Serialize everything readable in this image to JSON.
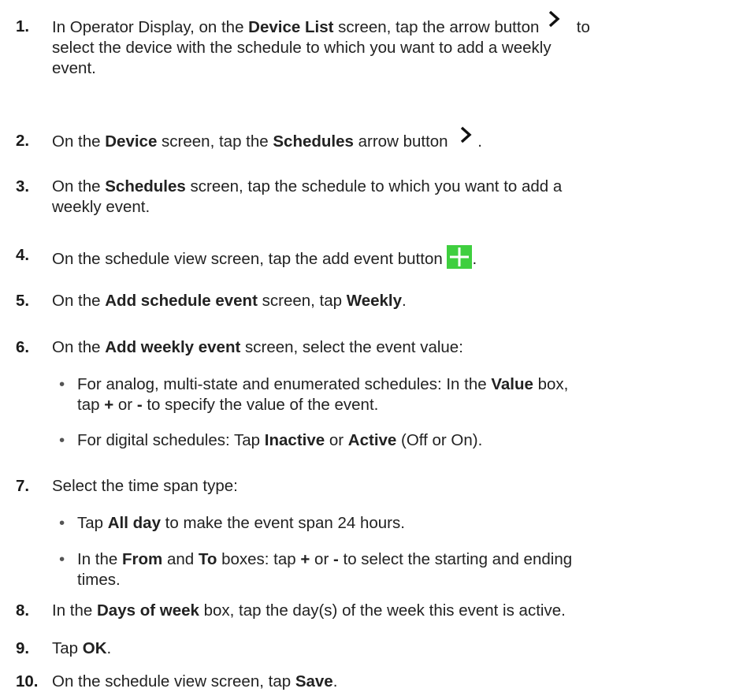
{
  "steps": [
    {
      "number": "1.",
      "p1": "In Operator Display, on the ",
      "b1": "Device List",
      "p2": " screen, tap the arrow button ",
      "p3": " to",
      "p4": "select the device with the schedule to which you want to add a weekly",
      "p5": "event."
    },
    {
      "number": "2.",
      "p1": "On the ",
      "b1": "Device",
      "p2": " screen, tap the ",
      "b2": "Schedules",
      "p3": " arrow button ",
      "p4": "."
    },
    {
      "number": "3.",
      "p1": "On the ",
      "b1": "Schedules",
      "p2": " screen, tap the schedule to which you want to add a",
      "p3": "weekly event."
    },
    {
      "number": "4.",
      "p1": "On the schedule view screen, tap the add event button ",
      "p2": "."
    },
    {
      "number": "5.",
      "p1": "On the ",
      "b1": "Add schedule event",
      "p2": " screen, tap ",
      "b2": "Weekly",
      "p3": "."
    },
    {
      "number": "6.",
      "p1": "On the ",
      "b1": "Add weekly event",
      "p2": " screen, select the event value:",
      "bullets": [
        {
          "p1": "For analog, multi-state and enumerated schedules: In the ",
          "b1": "Value",
          "p2": " box,",
          "p3": "tap ",
          "b2": "+",
          "p4": " or ",
          "b3": "-",
          "p5": " to specify the value of the event."
        },
        {
          "p1": "For digital schedules: Tap ",
          "b1": "Inactive",
          "p2": " or ",
          "b2": "Active",
          "p3": " (Off or On)."
        }
      ]
    },
    {
      "number": "7.",
      "p1": "Select the time span type:",
      "bullets": [
        {
          "p1": "Tap ",
          "b1": "All day",
          "p2": " to make the event span 24 hours."
        },
        {
          "p1": "In the ",
          "b1": "From",
          "p2": " and ",
          "b2": "To",
          "p3": " boxes: tap ",
          "b3": "+",
          "p4": " or ",
          "b4": "-",
          "p5": " to select the starting and ending",
          "p6": "times."
        }
      ]
    },
    {
      "number": "8.",
      "p1": "In the ",
      "b1": "Days of week",
      "p2": " box, tap the day(s) of the week this event is active."
    },
    {
      "number": "9.",
      "p1": "Tap ",
      "b1": "OK",
      "p2": "."
    },
    {
      "number": "10.",
      "p1": "On the schedule view screen, tap ",
      "b1": "Save",
      "p2": "."
    }
  ],
  "bullet_char": "•",
  "icons": {
    "arrow": "chevron-right-icon",
    "add": "add-event-plus-icon"
  },
  "colors": {
    "text": "#222222",
    "add_button": "#3fcf3f"
  }
}
